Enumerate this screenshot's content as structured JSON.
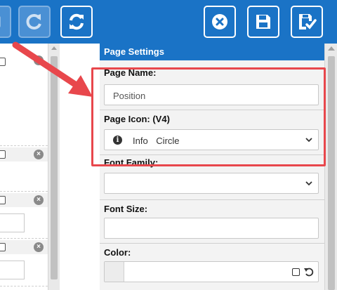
{
  "toolbar": {
    "buttons": [
      {
        "name": "copy-button",
        "icon": "copy-icon",
        "state": "disabled"
      },
      {
        "name": "redo-button",
        "icon": "redo-icon",
        "state": "disabled"
      },
      {
        "name": "refresh-button",
        "icon": "refresh-icon",
        "state": "enabled"
      },
      {
        "name": "cancel-button",
        "icon": "close-circle-icon",
        "state": "enabled"
      },
      {
        "name": "save-button",
        "icon": "floppy-disk-icon",
        "state": "enabled"
      },
      {
        "name": "save-and-check-button",
        "icon": "save-check-icon",
        "state": "enabled"
      }
    ]
  },
  "settings": {
    "title": "Page Settings",
    "page_name": {
      "label": "Page Name:",
      "value": "Position"
    },
    "page_icon": {
      "label": "Page Icon: (V4)",
      "value": "Info  Circle",
      "icon": "info-circle-icon"
    },
    "font_family": {
      "label": "Font Family:",
      "value": ""
    },
    "font_size": {
      "label": "Font Size:",
      "value": ""
    },
    "color": {
      "label": "Color:",
      "value": ""
    }
  },
  "colors": {
    "accent": "#1a73c6",
    "highlight": "#e8474c",
    "panel_bg": "#f3f3f3"
  }
}
